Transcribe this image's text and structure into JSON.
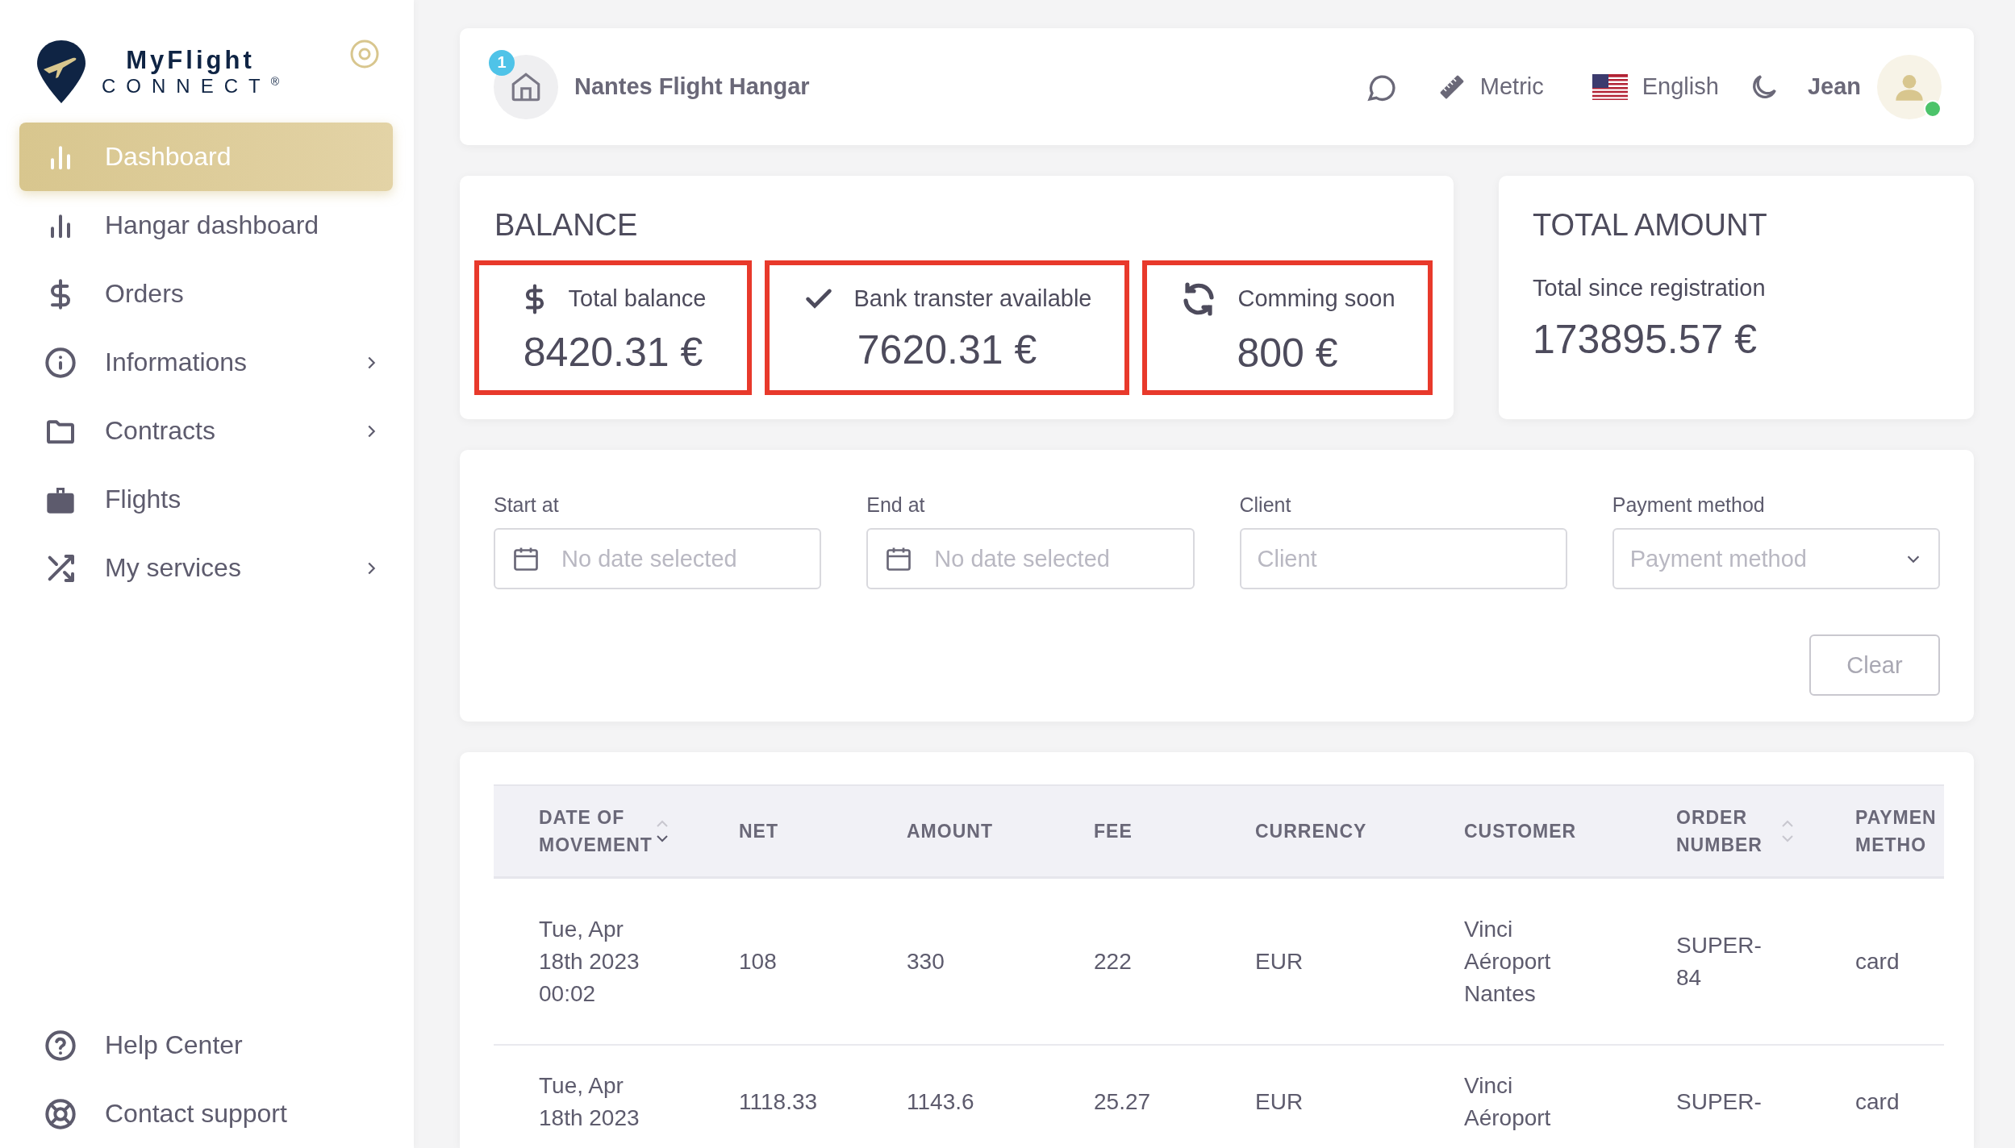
{
  "sidebar": {
    "logo": {
      "name": "MyFlight",
      "sub": "CONNECT",
      "mark": "®"
    },
    "items": [
      {
        "label": "Dashboard",
        "selected": true,
        "expandable": false
      },
      {
        "label": "Hangar dashboard",
        "selected": false,
        "expandable": false
      },
      {
        "label": "Orders",
        "selected": false,
        "expandable": false
      },
      {
        "label": "Informations",
        "selected": false,
        "expandable": true
      },
      {
        "label": "Contracts",
        "selected": false,
        "expandable": true
      },
      {
        "label": "Flights",
        "selected": false,
        "expandable": false
      },
      {
        "label": "My services",
        "selected": false,
        "expandable": true
      }
    ],
    "footer_items": [
      {
        "label": "Help Center"
      },
      {
        "label": "Contact support"
      }
    ]
  },
  "header": {
    "notification_count": "1",
    "hangar": "Nantes Flight Hangar",
    "units": "Metric",
    "language": "English",
    "user": "Jean",
    "online": true
  },
  "balance": {
    "title": "BALANCE",
    "stats": [
      {
        "label": "Total balance",
        "value": "8420.31 €"
      },
      {
        "label": "Bank transter available",
        "value": "7620.31 €"
      },
      {
        "label": "Comming soon",
        "value": "800 €"
      }
    ]
  },
  "total": {
    "title": "TOTAL AMOUNT",
    "label": "Total since registration",
    "value": "173895.57 €"
  },
  "filters": {
    "fields": [
      {
        "kind": "date",
        "label": "Start at",
        "placeholder": "No date selected"
      },
      {
        "kind": "date",
        "label": "End at",
        "placeholder": "No date selected"
      },
      {
        "kind": "text",
        "label": "Client",
        "placeholder": "Client"
      },
      {
        "kind": "select",
        "label": "Payment method",
        "placeholder": "Payment method"
      }
    ],
    "clear": "Clear"
  },
  "table": {
    "columns": [
      {
        "label": "DATE OF MOVEMENT",
        "sortable": true,
        "sorted": true
      },
      {
        "label": "NET"
      },
      {
        "label": "AMOUNT"
      },
      {
        "label": "FEE"
      },
      {
        "label": "CURRENCY"
      },
      {
        "label": "CUSTOMER"
      },
      {
        "label": "ORDER NUMBER",
        "sortable": true,
        "sorted": false
      },
      {
        "label": "PAYMEN METHO"
      }
    ],
    "rows": [
      [
        "Tue, Apr 18th 2023 00:02",
        "108",
        "330",
        "222",
        "EUR",
        "Vinci Aéroport Nantes",
        "SUPER-84",
        "card"
      ],
      [
        "Tue, Apr 18th 2023",
        "1118.33",
        "1143.6",
        "25.27",
        "EUR",
        "Vinci Aéroport",
        "SUPER-",
        "card"
      ]
    ]
  }
}
